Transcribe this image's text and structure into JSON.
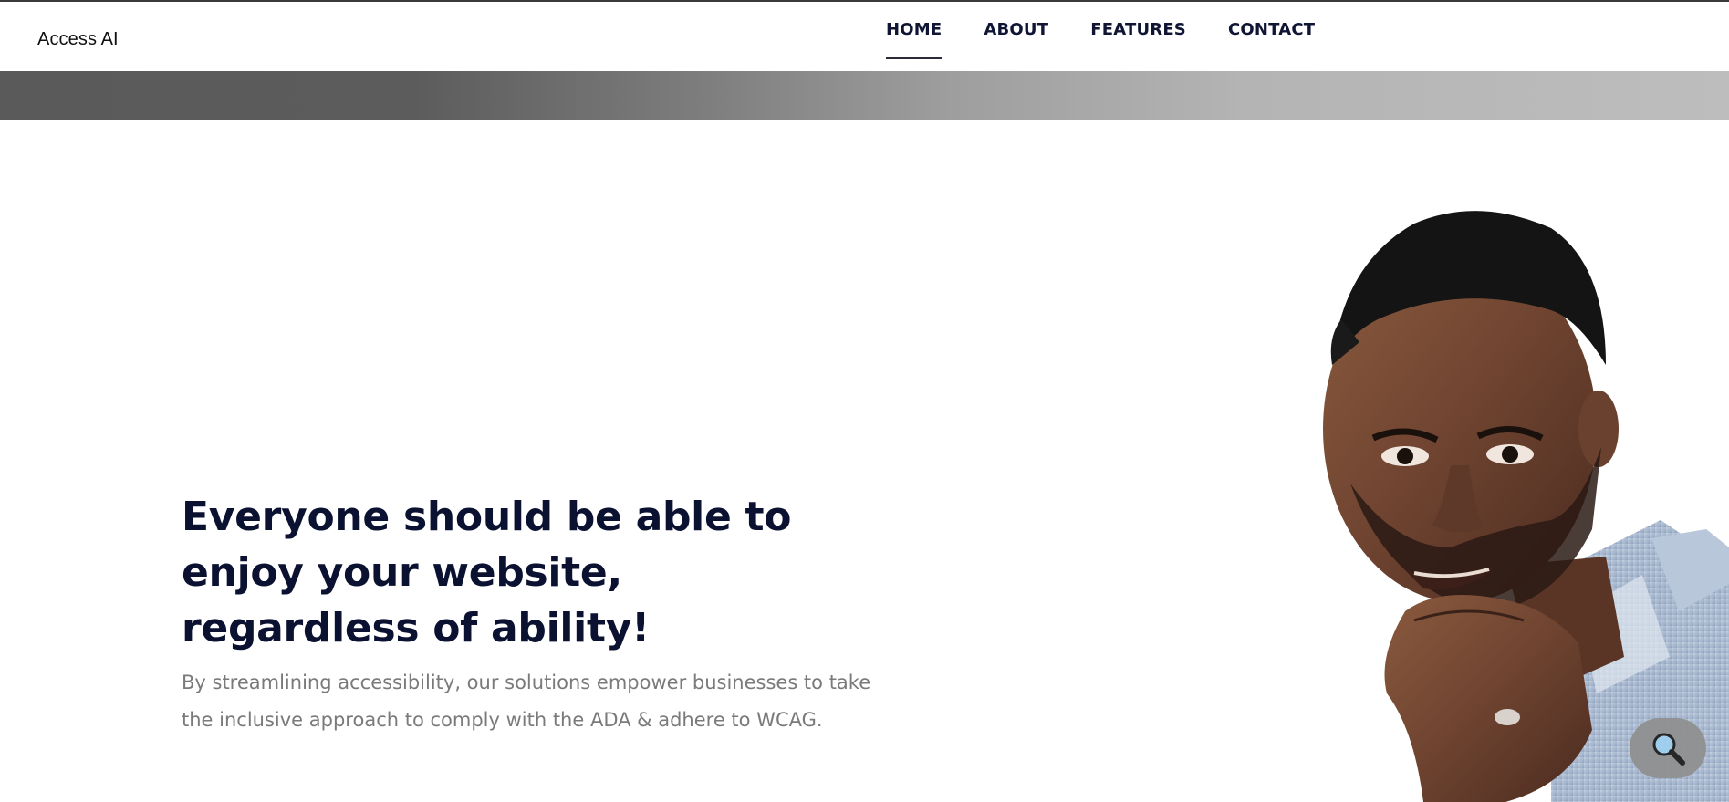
{
  "brand": {
    "logo_text": "Access AI"
  },
  "nav": {
    "items": [
      {
        "label": "HOME",
        "active": true
      },
      {
        "label": "ABOUT",
        "active": false
      },
      {
        "label": "FEATURES",
        "active": false
      },
      {
        "label": "CONTACT",
        "active": false
      }
    ]
  },
  "hero": {
    "title_line1": "Everyone should be able to",
    "title_line2": "enjoy your website,",
    "title_line3": "regardless of ability!",
    "subtitle_line1": "By streamlining accessibility, our solutions empower businesses to take",
    "subtitle_line2": "the inclusive approach to comply with the ADA & adhere to WCAG.",
    "image_icon": "person-thinking-photo"
  },
  "fab": {
    "icon": "search-icon"
  },
  "colors": {
    "nav_text": "#0f1533",
    "title_text": "#0b1130",
    "subtitle_text": "#7a7a7a",
    "banner_start": "#5a5a5a",
    "banner_end": "#bdbdbd"
  }
}
